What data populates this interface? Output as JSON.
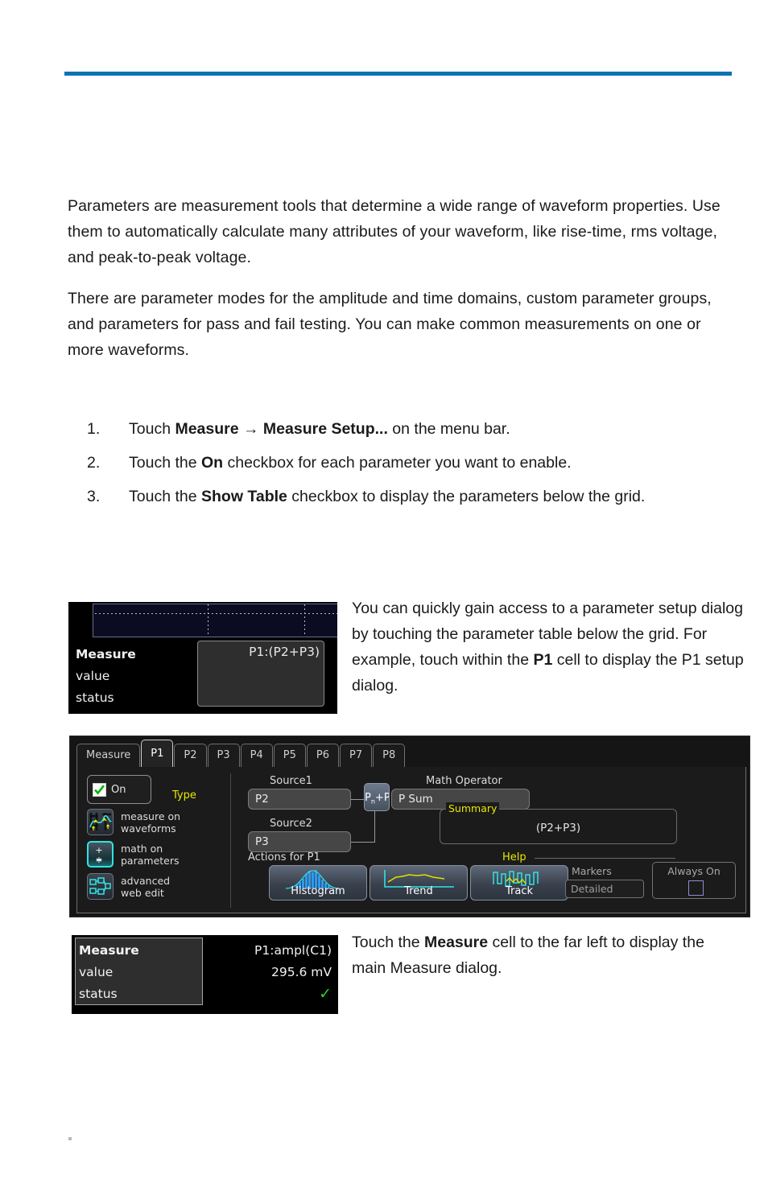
{
  "page": {
    "accent_color": "#0b72b5",
    "footer_mark": "."
  },
  "intro": {
    "paragraph1": "Parameters are measurement tools that determine a wide range of waveform properties. Use them to automatically calculate many attributes of your waveform, like rise-time, rms voltage, and peak-to-peak voltage.",
    "paragraph2": "There are parameter modes for the amplitude and time domains, custom parameter groups, and parameters for pass and fail testing. You can make common measurements on one or more waveforms."
  },
  "steps": [
    {
      "num": "1.",
      "pre": "Touch ",
      "bold": "Measure → Measure Setup...",
      "post": " on the menu bar."
    },
    {
      "num": "2.",
      "pre": "Touch the ",
      "bold": "On",
      "post": " checkbox for each parameter you want to enable."
    },
    {
      "num": "3.",
      "pre": "Touch the ",
      "bold": "Show Table",
      "post": " checkbox to display the parameters below the grid."
    }
  ],
  "callout1": {
    "pre": "You can quickly gain access to a parameter setup dialog by touching the parameter table below the grid. For example, touch within the ",
    "bold": "P1",
    "post": " cell to display the P1 setup dialog."
  },
  "callout2": {
    "pre": "Touch the ",
    "bold": "Measure",
    "post": " cell to the far left to display the main Measure dialog."
  },
  "measure_table_top": {
    "rows": [
      {
        "label": "Measure",
        "value": "P1:(P2+P3)"
      },
      {
        "label": "value",
        "value": ""
      },
      {
        "label": "status",
        "value": ""
      }
    ]
  },
  "measure_table_bottom": {
    "rows": [
      {
        "label": "Measure",
        "value": "P1:ampl(C1)"
      },
      {
        "label": "value",
        "value": "295.6 mV"
      },
      {
        "label": "status",
        "value": "✓"
      }
    ]
  },
  "dialog": {
    "tabs": [
      {
        "label": "Measure",
        "active": false
      },
      {
        "label": "P1",
        "active": true
      },
      {
        "label": "P2",
        "active": false
      },
      {
        "label": "P3",
        "active": false
      },
      {
        "label": "P4",
        "active": false
      },
      {
        "label": "P5",
        "active": false
      },
      {
        "label": "P6",
        "active": false
      },
      {
        "label": "P7",
        "active": false
      },
      {
        "label": "P8",
        "active": false
      }
    ],
    "on_checkbox": {
      "label": "On",
      "checked": true,
      "check_color": "#00b400"
    },
    "type_label": "Type",
    "types": [
      {
        "label_line1": "measure on",
        "label_line2": "waveforms",
        "selected": false,
        "icon": "waveform-measure-icon"
      },
      {
        "label_line1": "math on",
        "label_line2": "parameters",
        "selected": true,
        "icon": "math-operators-icon",
        "glyph_line1": "+ −",
        "glyph_line2": "∗ ÷"
      },
      {
        "label_line1": "advanced",
        "label_line2": "web edit",
        "selected": false,
        "icon": "web-edit-icon"
      }
    ],
    "source1": {
      "label": "Source1",
      "value": "P2"
    },
    "source2": {
      "label": "Source2",
      "value": "P3"
    },
    "operator_button": {
      "glyph": "P",
      "sub1": "n",
      "plus": "+",
      "glyph2": "P",
      "sub2": "m"
    },
    "math_operator": {
      "label": "Math Operator",
      "value": "P Sum"
    },
    "summary": {
      "legend": "Summary",
      "value": "(P2+P3)"
    },
    "actions_label": "Actions for P1",
    "actions": [
      {
        "label": "Histogram",
        "icon": "histogram-icon"
      },
      {
        "label": "Trend",
        "icon": "trend-icon"
      },
      {
        "label": "Track",
        "icon": "track-icon"
      }
    ],
    "help_label": "Help",
    "markers": {
      "label": "Markers",
      "value": "Detailed"
    },
    "always_on": {
      "label": "Always On",
      "checked": false
    }
  }
}
